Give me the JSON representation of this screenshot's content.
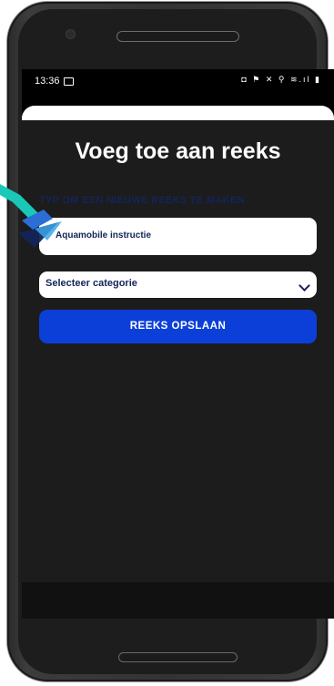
{
  "status_bar": {
    "time": "13:36",
    "icons": "◘ ⚑ ✕ ⚲ ≋.ıl ▮"
  },
  "dialog": {
    "title": "Voeg toe aan reeks",
    "hint": "TYP OM EEN NIEUWE REEKS TE MAKEN",
    "name_input_value": "Aquamobile instructie",
    "category_select": "Selecteer categorie",
    "save_button": "REEKS OPSLAAN"
  },
  "colors": {
    "title": "#ffffff",
    "hint": "#13245a",
    "button": "#0b3fd8",
    "background": "#1c1c1c"
  }
}
